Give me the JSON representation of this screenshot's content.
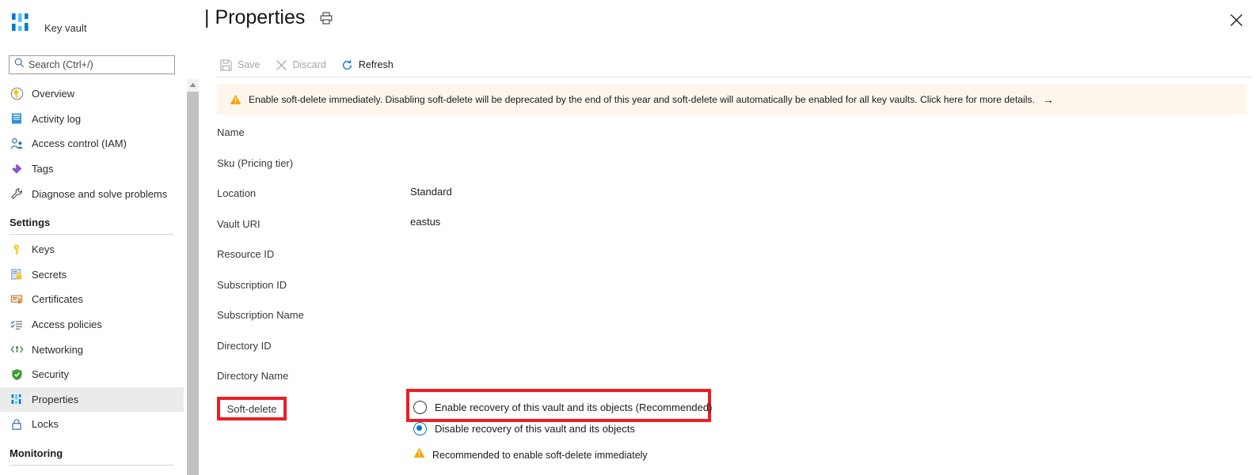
{
  "sidebar": {
    "resource_type": "Key vault",
    "logo_icon": "key-vault-icon",
    "search": {
      "placeholder": "Search (Ctrl+/)",
      "value": "",
      "icon": "search-icon"
    },
    "collapse_icon": "chevron-double-left-icon",
    "items": [
      {
        "label": "Overview",
        "icon": "overview-key-icon",
        "selected": false
      },
      {
        "label": "Activity log",
        "icon": "activity-log-icon",
        "selected": false
      },
      {
        "label": "Access control (IAM)",
        "icon": "access-control-icon",
        "selected": false
      },
      {
        "label": "Tags",
        "icon": "tags-icon",
        "selected": false
      },
      {
        "label": "Diagnose and solve problems",
        "icon": "diagnose-wrench-icon",
        "selected": false
      }
    ],
    "sections": [
      {
        "heading": "Settings",
        "items": [
          {
            "label": "Keys",
            "icon": "keys-icon",
            "selected": false
          },
          {
            "label": "Secrets",
            "icon": "secrets-icon",
            "selected": false
          },
          {
            "label": "Certificates",
            "icon": "certificates-icon",
            "selected": false
          },
          {
            "label": "Access policies",
            "icon": "access-policies-icon",
            "selected": false
          },
          {
            "label": "Networking",
            "icon": "networking-icon",
            "selected": false
          },
          {
            "label": "Security",
            "icon": "security-shield-icon",
            "selected": false
          },
          {
            "label": "Properties",
            "icon": "properties-icon",
            "selected": true
          },
          {
            "label": "Locks",
            "icon": "lock-icon",
            "selected": false
          }
        ]
      },
      {
        "heading": "Monitoring",
        "items": []
      }
    ],
    "scrollbar": {
      "up_arrow_icon": "scroll-up-arrow-icon"
    }
  },
  "header": {
    "title": "| Properties",
    "print_icon": "print-icon",
    "close_icon": "close-icon"
  },
  "command_bar": {
    "buttons": [
      {
        "label": "Save",
        "icon": "save-icon",
        "enabled": false
      },
      {
        "label": "Discard",
        "icon": "discard-x-icon",
        "enabled": false
      },
      {
        "label": "Refresh",
        "icon": "refresh-icon",
        "enabled": true
      }
    ]
  },
  "banner": {
    "icon": "warning-triangle-icon",
    "text": "Enable soft-delete immediately. Disabling soft-delete will be deprecated by the end of this year and soft-delete will automatically be enabled for all key vaults. Click here for more details.",
    "arrow": "→",
    "background_color": "#fdf6ec",
    "icon_color": "#f7a501"
  },
  "properties": [
    {
      "label": "Name",
      "value": ""
    },
    {
      "label": "Sku (Pricing tier)",
      "value": "Standard"
    },
    {
      "label": "Location",
      "value": "eastus"
    },
    {
      "label": "Vault URI",
      "value": ""
    },
    {
      "label": "Resource ID",
      "value": ""
    },
    {
      "label": "Subscription ID",
      "value": ""
    },
    {
      "label": "Subscription Name",
      "value": ""
    },
    {
      "label": "Directory ID",
      "value": ""
    },
    {
      "label": "Directory Name",
      "value": ""
    }
  ],
  "soft_delete": {
    "label": "Soft-delete",
    "options": [
      {
        "label": "Enable recovery of this vault and its objects (Recommended)",
        "selected": false
      },
      {
        "label": "Disable recovery of this vault and its objects",
        "selected": true
      }
    ],
    "note": {
      "icon": "warning-triangle-icon",
      "text": "Recommended to enable soft-delete immediately"
    }
  },
  "annotations": {
    "highlight_color": "#ee1c25",
    "boxes": [
      {
        "name": "soft-delete-label-highlight"
      },
      {
        "name": "enable-recovery-option-highlight"
      }
    ]
  }
}
